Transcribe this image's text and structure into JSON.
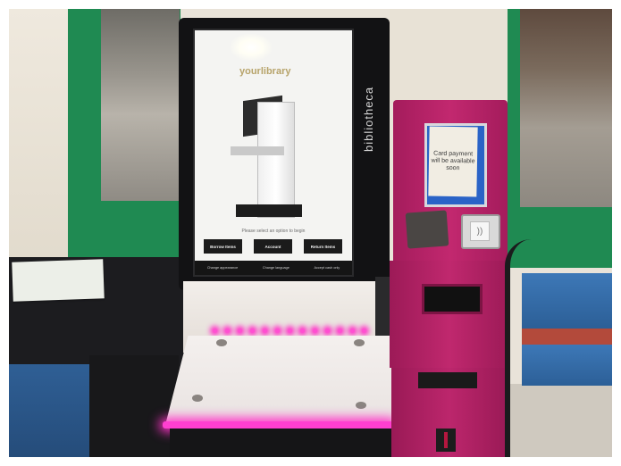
{
  "scene": {
    "kiosk_brand": "bibliotheca",
    "screen": {
      "logo": "yourlibrary",
      "prompt": "Please select an option to begin",
      "buttons": [
        "Borrow Items",
        "Account",
        "Return Items"
      ],
      "footer": [
        "Change appearance",
        "Change language",
        "Accept cash only"
      ]
    },
    "payment_notice": "Card payment will be available soon",
    "colors": {
      "kiosk_frame": "#121214",
      "payment_unit": "#b8246a",
      "led_glow": "#ff3fd0",
      "window_frame": "#1f8a52",
      "bench": "#3d78b7"
    }
  }
}
